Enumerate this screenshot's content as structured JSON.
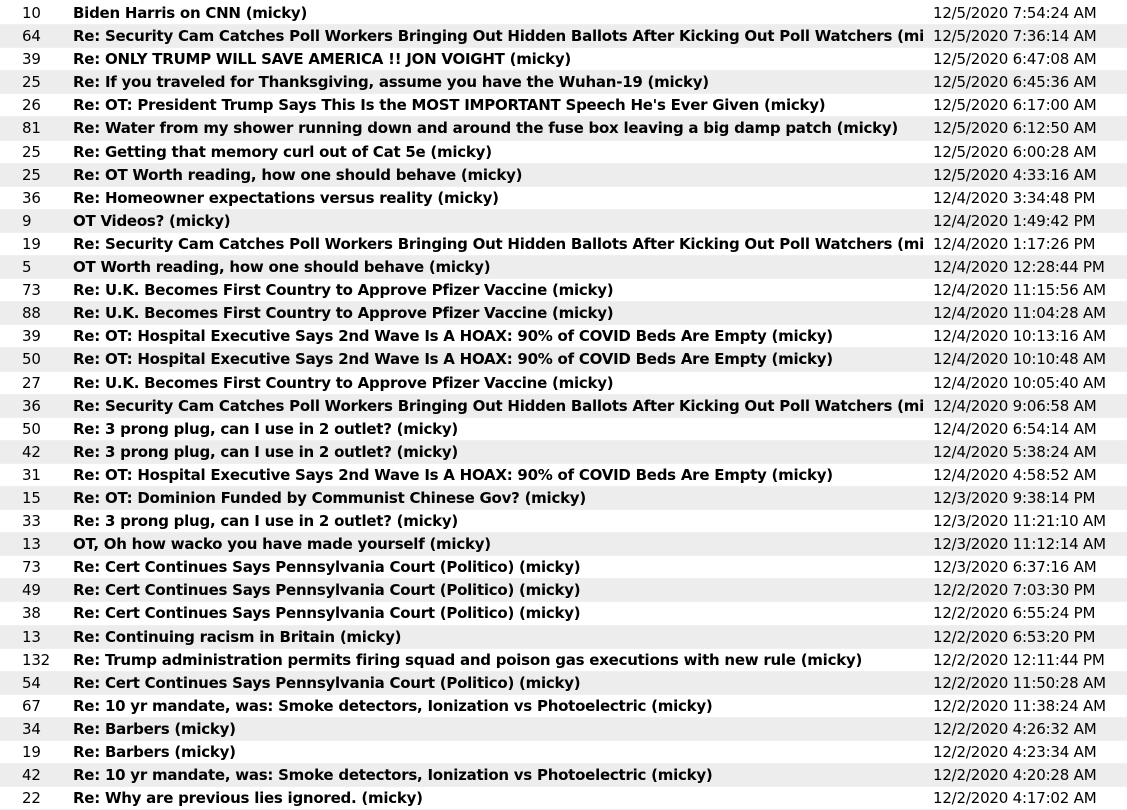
{
  "messages": [
    {
      "count": "10",
      "subject": "Biden Harris on CNN (micky)",
      "date": "12/5/2020 7:54:24 AM"
    },
    {
      "count": "64",
      "subject": "Re: Security Cam Catches Poll Workers Bringing Out Hidden Ballots After Kicking Out Poll Watchers (micky)",
      "date": "12/5/2020 7:36:14 AM"
    },
    {
      "count": "39",
      "subject": "Re: ONLY TRUMP WILL SAVE AMERICA !! JON VOIGHT (micky)",
      "date": "12/5/2020 6:47:08 AM"
    },
    {
      "count": "25",
      "subject": "Re: If you traveled for Thanksgiving, assume you have the Wuhan-19 (micky)",
      "date": "12/5/2020 6:45:36 AM"
    },
    {
      "count": "26",
      "subject": "Re: OT: President Trump Says This Is the MOST IMPORTANT Speech He's Ever Given (micky)",
      "date": "12/5/2020 6:17:00 AM"
    },
    {
      "count": "81",
      "subject": "Re: Water from my shower running down and around the fuse box leaving a big damp patch (micky)",
      "date": "12/5/2020 6:12:50 AM"
    },
    {
      "count": "25",
      "subject": "Re: Getting that memory curl out of Cat 5e (micky)",
      "date": "12/5/2020 6:00:28 AM"
    },
    {
      "count": "25",
      "subject": "Re: OT Worth reading, how one should behave (micky)",
      "date": "12/5/2020 4:33:16 AM"
    },
    {
      "count": "36",
      "subject": "Re: Homeowner expectations versus reality (micky)",
      "date": "12/4/2020 3:34:48 PM"
    },
    {
      "count": "9",
      "subject": "OT  Videos? (micky)",
      "date": "12/4/2020 1:49:42 PM"
    },
    {
      "count": "19",
      "subject": "Re: Security Cam Catches Poll Workers Bringing Out Hidden Ballots After Kicking Out Poll Watchers (micky)",
      "date": "12/4/2020 1:17:26 PM"
    },
    {
      "count": "5",
      "subject": "OT Worth reading, how one should behave (micky)",
      "date": "12/4/2020 12:28:44 PM"
    },
    {
      "count": "73",
      "subject": "Re: U.K. Becomes First Country to Approve Pfizer Vaccine (micky)",
      "date": "12/4/2020 11:15:56 AM"
    },
    {
      "count": "88",
      "subject": "Re: U.K. Becomes First Country to Approve Pfizer Vaccine (micky)",
      "date": "12/4/2020 11:04:28 AM"
    },
    {
      "count": "39",
      "subject": "Re: OT: Hospital Executive Says 2nd Wave Is A HOAX: 90% of COVID Beds Are Empty (micky)",
      "date": "12/4/2020 10:13:16 AM"
    },
    {
      "count": "50",
      "subject": "Re: OT: Hospital Executive Says 2nd Wave Is A HOAX: 90% of COVID Beds Are Empty (micky)",
      "date": "12/4/2020 10:10:48 AM"
    },
    {
      "count": "27",
      "subject": "Re: U.K. Becomes First Country to Approve Pfizer Vaccine (micky)",
      "date": "12/4/2020 10:05:40 AM"
    },
    {
      "count": "36",
      "subject": "Re: Security Cam Catches Poll Workers Bringing Out Hidden Ballots After Kicking Out Poll Watchers (micky)",
      "date": "12/4/2020 9:06:58 AM"
    },
    {
      "count": "50",
      "subject": "Re: 3 prong plug, can I use in 2 outlet? (micky)",
      "date": "12/4/2020 6:54:14 AM"
    },
    {
      "count": "42",
      "subject": "Re: 3 prong plug, can I use in 2 outlet? (micky)",
      "date": "12/4/2020 5:38:24 AM"
    },
    {
      "count": "31",
      "subject": "Re: OT: Hospital Executive Says 2nd Wave Is A HOAX: 90% of COVID Beds Are Empty (micky)",
      "date": "12/4/2020 4:58:52 AM"
    },
    {
      "count": "15",
      "subject": "Re: OT: Dominion Funded by Communist Chinese Gov? (micky)",
      "date": "12/3/2020 9:38:14 PM"
    },
    {
      "count": "33",
      "subject": "Re: 3 prong plug, can I use in 2 outlet? (micky)",
      "date": "12/3/2020 11:21:10 AM"
    },
    {
      "count": "13",
      "subject": "OT, Oh how wacko you have made yourself (micky)",
      "date": "12/3/2020 11:12:14 AM"
    },
    {
      "count": "73",
      "subject": "Re: Cert Continues Says Pennsylvania Court (Politico) (micky)",
      "date": "12/3/2020 6:37:16 AM"
    },
    {
      "count": "49",
      "subject": "Re: Cert Continues Says Pennsylvania Court (Politico) (micky)",
      "date": "12/2/2020 7:03:30 PM"
    },
    {
      "count": "38",
      "subject": "Re: Cert Continues Says Pennsylvania Court (Politico) (micky)",
      "date": "12/2/2020 6:55:24 PM"
    },
    {
      "count": "13",
      "subject": "Re: Continuing racism in Britain (micky)",
      "date": "12/2/2020 6:53:20 PM"
    },
    {
      "count": "132",
      "subject": "Re: Trump administration permits firing squad and poison gas executions with new rule (micky)",
      "date": "12/2/2020 12:11:44 PM"
    },
    {
      "count": "54",
      "subject": "Re: Cert Continues Says Pennsylvania Court (Politico) (micky)",
      "date": "12/2/2020 11:50:28 AM"
    },
    {
      "count": "67",
      "subject": "Re: 10 yr mandate, was: Smoke detectors, Ionization vs Photoelectric (micky)",
      "date": "12/2/2020 11:38:24 AM"
    },
    {
      "count": "34",
      "subject": "Re: Barbers (micky)",
      "date": "12/2/2020 4:26:32 AM"
    },
    {
      "count": "19",
      "subject": "Re: Barbers (micky)",
      "date": "12/2/2020 4:23:34 AM"
    },
    {
      "count": "42",
      "subject": "Re: 10 yr mandate, was: Smoke detectors, Ionization vs Photoelectric (micky)",
      "date": "12/2/2020 4:20:28 AM"
    },
    {
      "count": "22",
      "subject": "Re: Why are previous lies ignored. (micky)",
      "date": "12/2/2020 4:17:02 AM"
    }
  ]
}
